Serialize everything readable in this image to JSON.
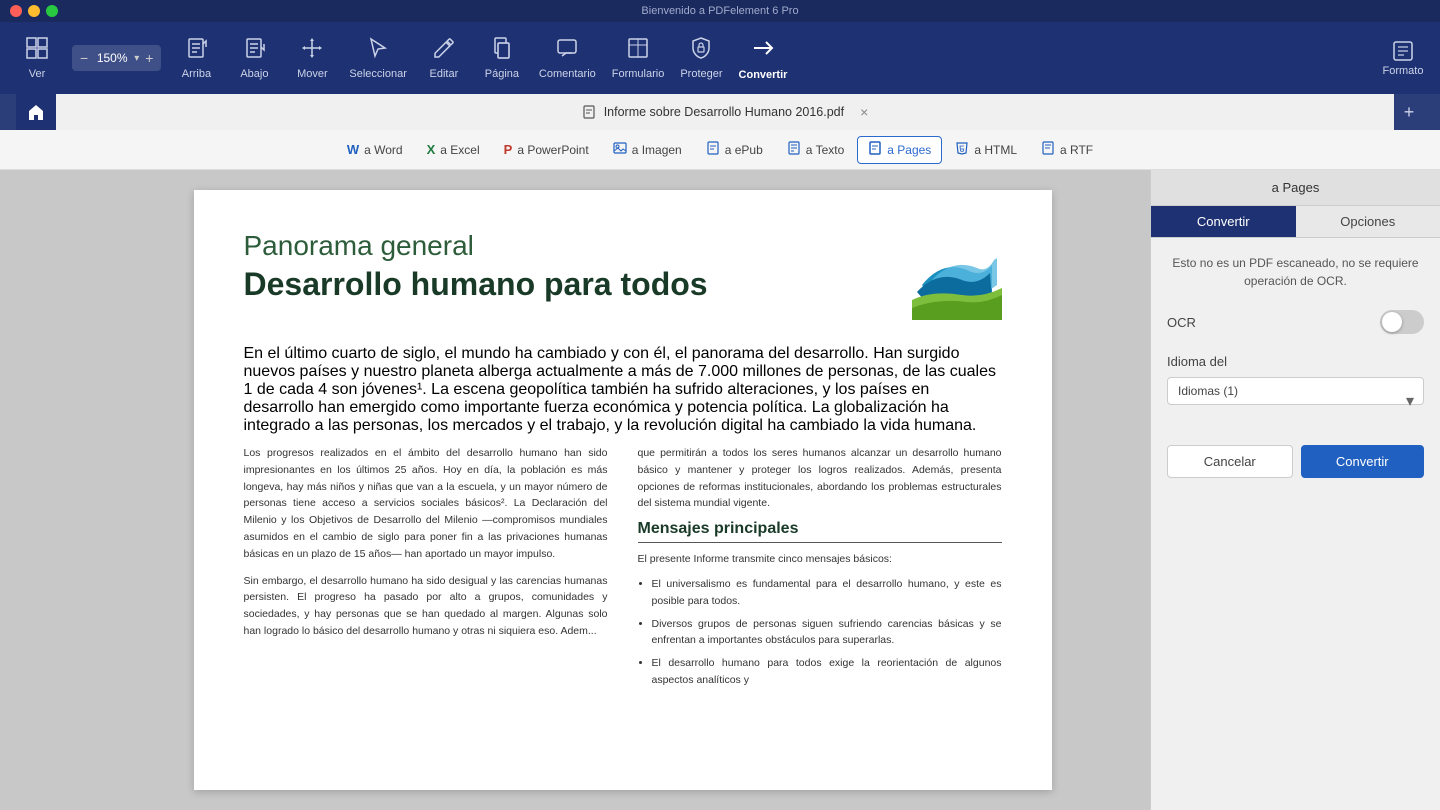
{
  "app": {
    "title": "Bienvenido a PDFelement 6 Pro"
  },
  "toolbar": {
    "zoom_value": "150%",
    "items": [
      {
        "id": "ver",
        "label": "Ver",
        "icon": "⊞"
      },
      {
        "id": "arriba",
        "label": "Arriba",
        "icon": "↑"
      },
      {
        "id": "abajo",
        "label": "Abajo",
        "icon": "↓"
      },
      {
        "id": "mover",
        "label": "Mover",
        "icon": "✋"
      },
      {
        "id": "seleccionar",
        "label": "Seleccionar",
        "icon": "↖"
      },
      {
        "id": "editar",
        "label": "Editar",
        "icon": "✏"
      },
      {
        "id": "pagina",
        "label": "Página",
        "icon": "📄"
      },
      {
        "id": "comentario",
        "label": "Comentario",
        "icon": "💬"
      },
      {
        "id": "formulario",
        "label": "Formulario",
        "icon": "☰"
      },
      {
        "id": "proteger",
        "label": "Proteger",
        "icon": "🔒"
      },
      {
        "id": "convertir",
        "label": "Convertir",
        "icon": "⇄"
      }
    ],
    "format_label": "Formato"
  },
  "tabbar": {
    "doc_title": "Informe sobre Desarrollo Humano 2016.pdf"
  },
  "convert_bar": {
    "buttons": [
      {
        "id": "word",
        "label": "a Word",
        "icon": "W"
      },
      {
        "id": "excel",
        "label": "a Excel",
        "icon": "X"
      },
      {
        "id": "powerpoint",
        "label": "a PowerPoint",
        "icon": "P"
      },
      {
        "id": "imagen",
        "label": "a Imagen",
        "icon": "🖼"
      },
      {
        "id": "epub",
        "label": "a ePub",
        "icon": "E"
      },
      {
        "id": "texto",
        "label": "a Texto",
        "icon": "T"
      },
      {
        "id": "pages",
        "label": "a Pages",
        "icon": "P",
        "active": true
      },
      {
        "id": "html",
        "label": "a HTML",
        "icon": "H"
      },
      {
        "id": "rtf",
        "label": "a RTF",
        "icon": "R"
      }
    ]
  },
  "pdf": {
    "title1": "Panorama general",
    "title2": "Desarrollo humano para todos",
    "intro": "En el último cuarto de siglo, el mundo ha cambiado y con él, el panorama del desarrollo. Han surgido nuevos países y nuestro planeta alberga actualmente a más de 7.000 millones de personas, de las cuales 1 de cada 4 son jóvenes¹. La escena geopolítica también ha sufrido alteraciones, y los países en desarrollo han emergido como importante fuerza económica y potencia política. La globalización ha integrado a las personas, los mercados y el trabajo, y la revolución digital ha cambiado la vida humana.",
    "col_left_p1": "Los progresos realizados en el ámbito del desarrollo humano han sido impresionantes en los últimos 25 años. Hoy en día, la población es más longeva, hay más niños y niñas que van a la escuela, y un mayor número de personas tiene acceso a servicios sociales básicos². La Declaración del Milenio y los Objetivos de Desarrollo del Milenio —compromisos mundiales asumidos en el cambio de siglo para poner fin a las privaciones humanas básicas en un plazo de 15 años— han aportado un mayor impulso.",
    "col_left_p2": "Sin embargo, el desarrollo humano ha sido desigual y las carencias humanas persisten. El progreso ha pasado por alto a grupos, comunidades y sociedades, y hay personas que se han quedado al margen. Algunas solo han logrado lo básico del desarrollo humano y otras ni siquiera eso. Adem...",
    "col_right_p1": "que permitirán a todos los seres humanos alcanzar un desarrollo humano básico y mantener y proteger los logros realizados. Además, presenta opciones de reformas institucionales, abordando los problemas estructurales del sistema mundial vigente.",
    "mensajes_title": "Mensajes principales",
    "mensajes_intro": "El presente Informe transmite cinco mensajes básicos:",
    "mensajes_items": [
      "El universalismo es fundamental para el desarrollo humano, y este es posible para todos.",
      "Diversos grupos de personas siguen sufriendo carencias básicas y se enfrentan a importantes obstáculos para superarlas.",
      "El desarrollo humano para todos exige la reorientación de algunos aspectos analíticos y"
    ]
  },
  "right_panel": {
    "title": "a Pages",
    "tab_convert": "Convertir",
    "tab_options": "Opciones",
    "info_text": "Esto no es un PDF escaneado, no se requiere operación de OCR.",
    "ocr_label": "OCR",
    "idioma_label": "Idioma del",
    "idioma_placeholder": "Idiomas (1)",
    "btn_cancel": "Cancelar",
    "btn_convert": "Convertir"
  }
}
